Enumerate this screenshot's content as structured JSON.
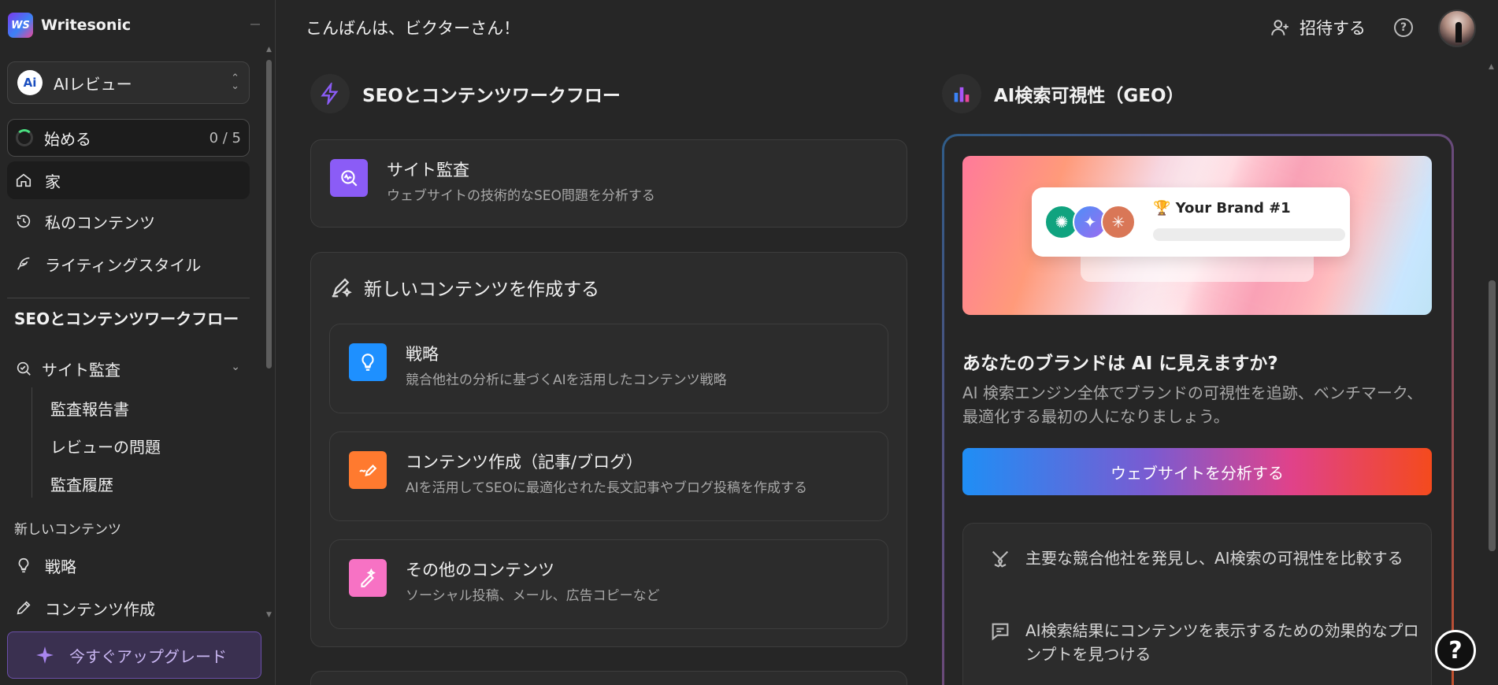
{
  "app": {
    "logo_text": "Writesonic",
    "logo_mark": "WS"
  },
  "sidebar": {
    "project": {
      "badge": "Ai",
      "name": "AIレビュー"
    },
    "start": {
      "label": "始める",
      "count": "0 / 5"
    },
    "nav": [
      {
        "label": "家",
        "icon": "home-icon"
      },
      {
        "label": "私のコンテンツ",
        "icon": "history-icon"
      },
      {
        "label": "ライティングスタイル",
        "icon": "feather-icon"
      }
    ],
    "section_title": "SEOとコンテンツワークフロー",
    "audit": {
      "label": "サイト監査",
      "icon": "audit-search-icon",
      "children": [
        "監査報告書",
        "レビューの問題",
        "監査履歴"
      ]
    },
    "new_content_label": "新しいコンテンツ",
    "new_content_items": [
      {
        "label": "戦略",
        "icon": "lightbulb-icon"
      },
      {
        "label": "コンテンツ作成",
        "icon": "pencil-icon"
      }
    ],
    "upgrade_label": "今すぐアップグレード"
  },
  "topbar": {
    "greeting": "こんばんは、ビクターさん！",
    "invite_label": "招待する",
    "help_glyph": "?"
  },
  "seo_column": {
    "title": "SEOとコンテンツワークフロー",
    "site_audit": {
      "title": "サイト監査",
      "desc": "ウェブサイトの技術的なSEO問題を分析する"
    },
    "create": {
      "title": "新しいコンテンツを作成する",
      "items": [
        {
          "title": "戦略",
          "desc": "競合他社の分析に基づくAIを活用したコンテンツ戦略",
          "color": "#1e90ff"
        },
        {
          "title": "コンテンツ作成（記事/ブログ）",
          "desc": "AIを活用してSEOに最適化された長文記事やブログ投稿を作成する",
          "color": "#ff7a2f"
        },
        {
          "title": "その他のコンテンツ",
          "desc": "ソーシャル投稿、メール、広告コピーなど",
          "color": "#f772c4"
        }
      ]
    }
  },
  "geo_column": {
    "title": "AI検索可視性（GEO）",
    "hero": {
      "brand_label": "🏆 Your Brand #1"
    },
    "question": "あなたのブランドは AI に見えますか?",
    "desc": "AI 検索エンジン全体でブランドの可視性を追跡、ベンチマーク、最適化する最初の人になりましょう。",
    "button_label": "ウェブサイトを分析する",
    "features": [
      "主要な競合他社を発見し、AI検索の可視性を比較する",
      "AI検索結果にコンテンツを表示するための効果的なプロンプトを見つける"
    ]
  },
  "colors": {
    "accent_purple": "#8b5cf6",
    "audit_icon_bg": "#8b5cf6",
    "button_gradient": [
      "#1f8ef5",
      "#e0428a",
      "#f44a1d"
    ]
  }
}
